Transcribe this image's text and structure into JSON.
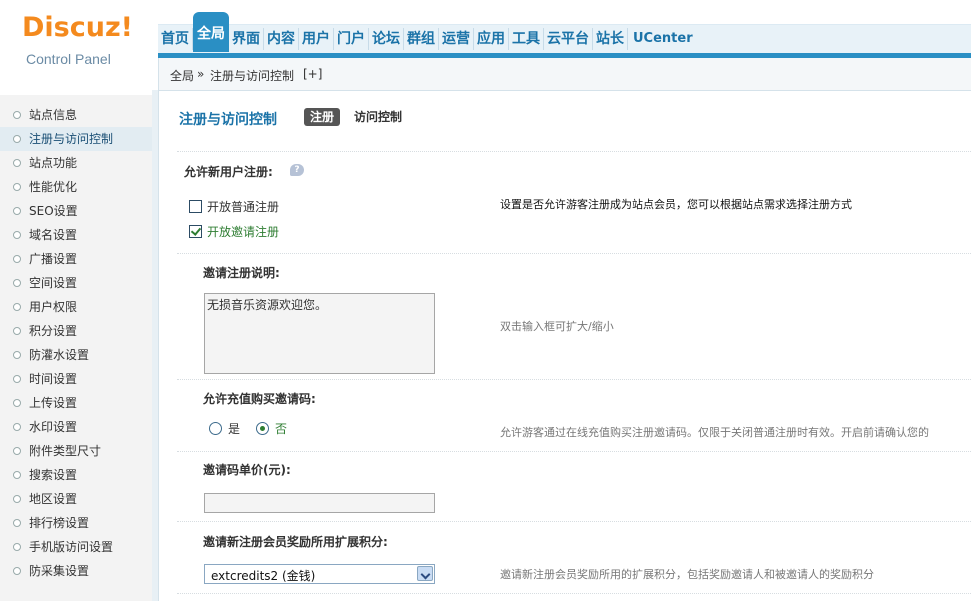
{
  "logo": {
    "brand": "Discuz!",
    "sub": "Control Panel"
  },
  "nav": [
    "首页",
    "全局",
    "界面",
    "内容",
    "用户",
    "门户",
    "论坛",
    "群组",
    "运营",
    "应用",
    "工具",
    "云平台",
    "站长",
    "UCenter"
  ],
  "nav_active": "全局",
  "breadcrumb": {
    "root": "全局",
    "sep": "»",
    "current": "注册与访问控制",
    "add": "[+]"
  },
  "sidebar": {
    "items": [
      "站点信息",
      "注册与访问控制",
      "站点功能",
      "性能优化",
      "SEO设置",
      "域名设置",
      "广播设置",
      "空间设置",
      "用户权限",
      "积分设置",
      "防灌水设置",
      "时间设置",
      "上传设置",
      "水印设置",
      "附件类型尺寸",
      "搜索设置",
      "地区设置",
      "排行榜设置",
      "手机版访问设置",
      "防采集设置"
    ],
    "active": "注册与访问控制"
  },
  "main": {
    "title": "注册与访问控制",
    "tabs": [
      "注册",
      "访问控制"
    ],
    "allow_reg_label": "允许新用户注册:",
    "help_icon": "help-bubble-icon",
    "opt_normal": "开放普通注册",
    "opt_invite": "开放邀请注册",
    "allow_reg_desc": "设置是否允许游客注册成为站点会员，您可以根据站点需求选择注册方式",
    "invite_desc_label": "邀请注册说明:",
    "invite_desc_value": "无损音乐资源欢迎您。",
    "invite_desc_tip": "双击输入框可扩大/缩小",
    "buy_code_label": "允许充值购买邀请码:",
    "yes": "是",
    "no": "否",
    "buy_code_desc": "允许游客通过在线充值购买注册邀请码。仅限于关闭普通注册时有效。开启前请确认您的",
    "price_label": "邀请码单价(元):",
    "price_value": "",
    "reward_label": "邀请新注册会员奖励所用扩展积分:",
    "reward_value": "extcredits2 (金钱)",
    "reward_desc": "邀请新注册会员奖励所用的扩展积分，包括奖励邀请人和被邀请人的奖励积分"
  },
  "colors": {
    "accent": "#2a8fc4",
    "logo": "#f48a1e",
    "checked": "#2e7d32"
  }
}
